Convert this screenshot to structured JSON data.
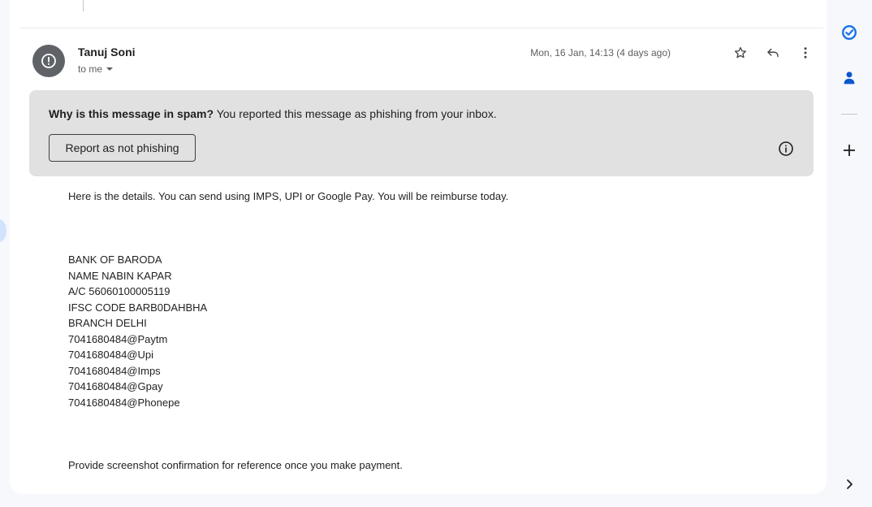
{
  "message": {
    "sender_name": "Tanuj Soni",
    "recipient_label": "to me",
    "date": "Mon, 16 Jan, 14:13 (4 days ago)"
  },
  "spam_banner": {
    "heading": "Why is this message in spam?",
    "reason": "You reported this message as phishing from your inbox.",
    "button_label": "Report as not phishing"
  },
  "body": {
    "intro": "Here is the details. You can send using IMPS, UPI or Google Pay. You will be reimburse today.",
    "details": [
      "BANK OF BARODA",
      "NAME NABIN KAPAR",
      "A/C 56060100005119",
      "IFSC CODE BARB0DAHBHA",
      "BRANCH DELHI",
      "7041680484@Paytm",
      "7041680484@Upi",
      "7041680484@Imps",
      "7041680484@Gpay",
      "7041680484@Phonepe"
    ],
    "closing": "Provide screenshot confirmation for reference once you make payment."
  },
  "icons": {
    "avatar": "warning-icon",
    "star": "star-icon",
    "reply": "reply-icon",
    "more": "more-vert-icon",
    "info": "info-icon",
    "tasks": "tasks-icon",
    "contacts": "contacts-icon",
    "add": "add-icon",
    "expand": "chevron-right-icon"
  },
  "colors": {
    "avatar_bg": "#5f6368",
    "spam_banner_bg": "#e1e1e1",
    "tasks_blue": "#1a73e8",
    "contacts_blue": "#0b57d0"
  }
}
